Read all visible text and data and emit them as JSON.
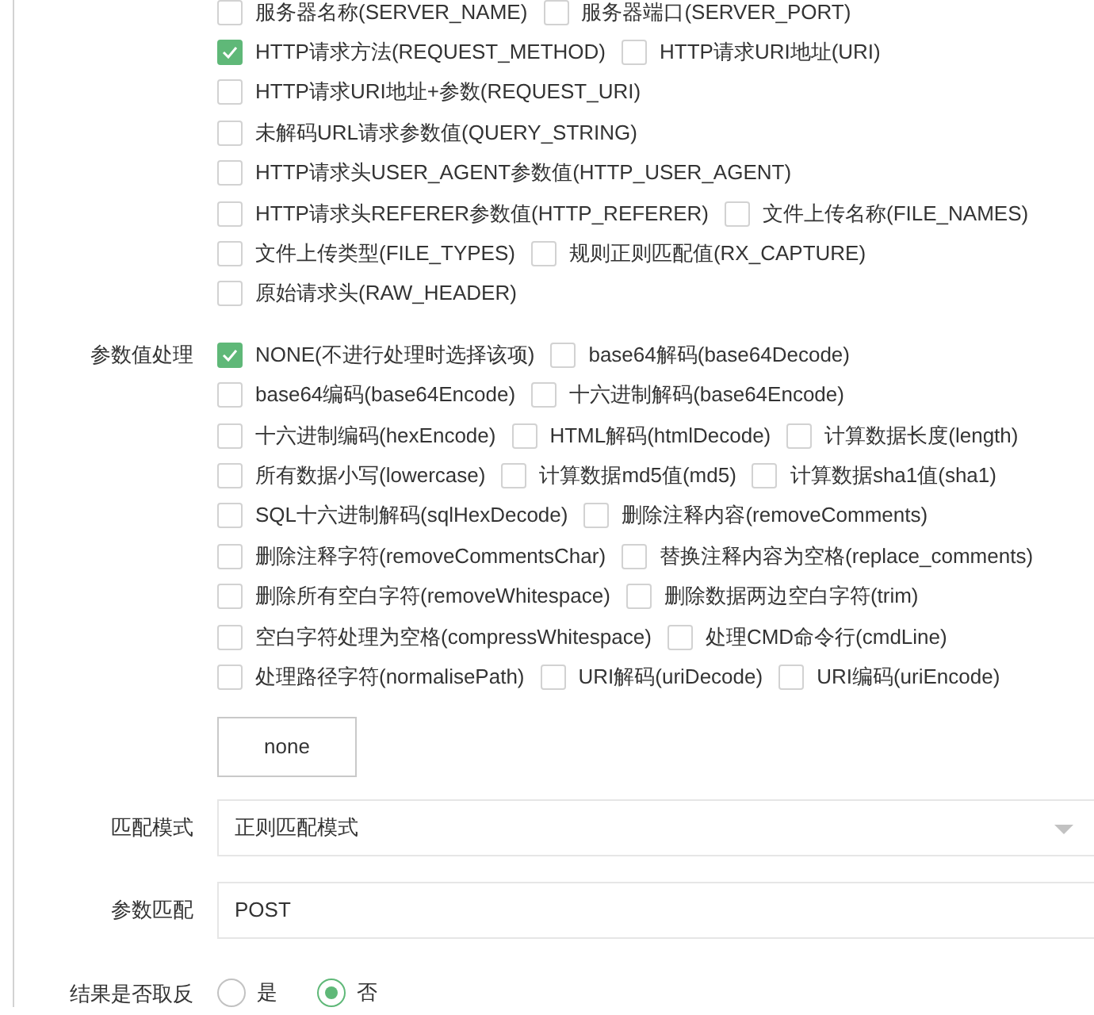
{
  "request_variables": {
    "rows": [
      [
        {
          "label": "服务器名称(SERVER_NAME)",
          "checked": false
        },
        {
          "label": "服务器端口(SERVER_PORT)",
          "checked": false
        }
      ],
      [
        {
          "label": "HTTP请求方法(REQUEST_METHOD)",
          "checked": true
        },
        {
          "label": "HTTP请求URI地址(URI)",
          "checked": false
        }
      ],
      [
        {
          "label": "HTTP请求URI地址+参数(REQUEST_URI)",
          "checked": false
        }
      ],
      [
        {
          "label": "未解码URL请求参数值(QUERY_STRING)",
          "checked": false
        }
      ],
      [
        {
          "label": "HTTP请求头USER_AGENT参数值(HTTP_USER_AGENT)",
          "checked": false
        }
      ],
      [
        {
          "label": "HTTP请求头REFERER参数值(HTTP_REFERER)",
          "checked": false
        },
        {
          "label": "文件上传名称(FILE_NAMES)",
          "checked": false
        }
      ],
      [
        {
          "label": "文件上传类型(FILE_TYPES)",
          "checked": false
        },
        {
          "label": "规则正则匹配值(RX_CAPTURE)",
          "checked": false
        }
      ],
      [
        {
          "label": "原始请求头(RAW_HEADER)",
          "checked": false
        }
      ]
    ]
  },
  "param_processing": {
    "label": "参数值处理",
    "rows": [
      [
        {
          "label": "NONE(不进行处理时选择该项)",
          "checked": true
        },
        {
          "label": "base64解码(base64Decode)",
          "checked": false
        }
      ],
      [
        {
          "label": "base64编码(base64Encode)",
          "checked": false
        },
        {
          "label": "十六进制解码(base64Encode)",
          "checked": false
        }
      ],
      [
        {
          "label": "十六进制编码(hexEncode)",
          "checked": false
        },
        {
          "label": "HTML解码(htmlDecode)",
          "checked": false
        },
        {
          "label": "计算数据长度(length)",
          "checked": false
        }
      ],
      [
        {
          "label": "所有数据小写(lowercase)",
          "checked": false
        },
        {
          "label": "计算数据md5值(md5)",
          "checked": false
        },
        {
          "label": "计算数据sha1值(sha1)",
          "checked": false
        }
      ],
      [
        {
          "label": "SQL十六进制解码(sqlHexDecode)",
          "checked": false
        },
        {
          "label": "删除注释内容(removeComments)",
          "checked": false
        }
      ],
      [
        {
          "label": "删除注释字符(removeCommentsChar)",
          "checked": false
        },
        {
          "label": "替换注释内容为空格(replace_comments)",
          "checked": false
        }
      ],
      [
        {
          "label": "删除所有空白字符(removeWhitespace)",
          "checked": false
        },
        {
          "label": "删除数据两边空白字符(trim)",
          "checked": false
        }
      ],
      [
        {
          "label": "空白字符处理为空格(compressWhitespace)",
          "checked": false
        },
        {
          "label": "处理CMD命令行(cmdLine)",
          "checked": false
        }
      ],
      [
        {
          "label": "处理路径字符(normalisePath)",
          "checked": false
        },
        {
          "label": "URI解码(uriDecode)",
          "checked": false
        },
        {
          "label": "URI编码(uriEncode)",
          "checked": false
        }
      ]
    ]
  },
  "none_button": "none",
  "match_mode": {
    "label": "匹配模式",
    "value": "正则匹配模式"
  },
  "param_match": {
    "label": "参数匹配",
    "value": "POST"
  },
  "negate_result": {
    "label": "结果是否取反",
    "options": [
      {
        "label": "是",
        "selected": false
      },
      {
        "label": "否",
        "selected": true
      }
    ]
  }
}
